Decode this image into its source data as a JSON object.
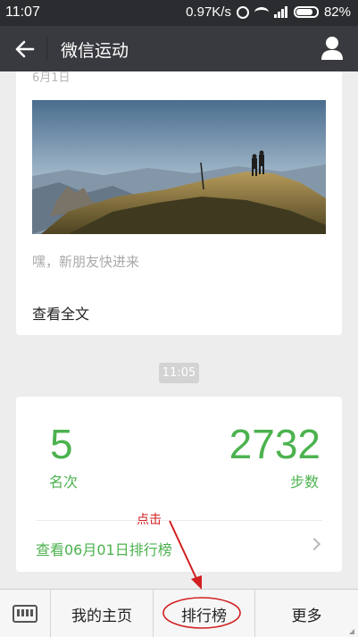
{
  "status_bar": {
    "time": "11:07",
    "speed": "0.97K/s",
    "battery": "82%",
    "battery_level": 0.82
  },
  "app_bar": {
    "title": "微信运动"
  },
  "post": {
    "date": "6月1日",
    "text": "嘿，新朋友快进来",
    "view_full_label": "查看全文"
  },
  "timestamp": "11:05",
  "stats": {
    "rank_value": "5",
    "rank_label": "名次",
    "steps_value": "2732",
    "steps_label": "步数",
    "link_label": "查看06月01日排行榜"
  },
  "annotation": {
    "text": "点击",
    "color": "#d21f1f"
  },
  "bottom_menu": {
    "home_label": "我的主页",
    "rank_label": "排行榜",
    "more_label": "更多"
  },
  "colors": {
    "accent": "#4cb24f",
    "app_bar": "#393a3f"
  }
}
